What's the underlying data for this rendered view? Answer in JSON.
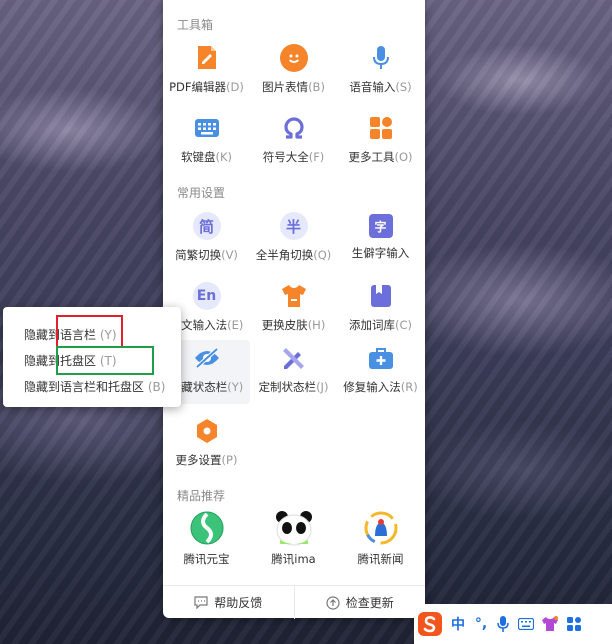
{
  "toolbox": {
    "title": "工具箱",
    "items": [
      {
        "label": "PDF编辑器",
        "key": "(D)"
      },
      {
        "label": "图片表情",
        "key": "(B)"
      },
      {
        "label": "语音输入",
        "key": "(S)"
      },
      {
        "label": "软键盘",
        "key": "(K)"
      },
      {
        "label": "符号大全",
        "key": "(F)"
      },
      {
        "label": "更多工具",
        "key": "(O)"
      }
    ]
  },
  "common": {
    "title": "常用设置",
    "items": [
      {
        "label": "简繁切换",
        "key": "(V)",
        "icon_text": "简"
      },
      {
        "label": "全半角切换",
        "key": "(Q)",
        "icon_text": "半"
      },
      {
        "label": "生僻字输入",
        "key": "",
        "icon_text": "字"
      },
      {
        "label": "英文输入法",
        "key": "(E)",
        "icon_text": "En"
      },
      {
        "label": "更换皮肤",
        "key": "(H)"
      },
      {
        "label": "添加词库",
        "key": "(C)"
      },
      {
        "label": "隐藏状态栏",
        "key": "(Y)"
      },
      {
        "label": "定制状态栏",
        "key": "(J)"
      },
      {
        "label": "修复输入法",
        "key": "(R)"
      },
      {
        "label": "更多设置",
        "key": "(P)"
      }
    ]
  },
  "recommend": {
    "title": "精品推荐",
    "items": [
      {
        "label": "腾讯元宝"
      },
      {
        "label": "腾讯ima"
      },
      {
        "label": "腾讯新闻"
      }
    ]
  },
  "footer": {
    "help": "帮助反馈",
    "update": "检查更新"
  },
  "context_menu": {
    "items": [
      {
        "prefix": "隐藏到",
        "target": "语言栏",
        "key": "(Y)"
      },
      {
        "prefix": "隐藏到",
        "target": "托盘区",
        "key": "(T)"
      },
      {
        "prefix": "",
        "target": "隐藏到语言栏和托盘区",
        "key": "(B)"
      }
    ]
  },
  "taskbar": {
    "ime_mode": "中",
    "punct": "°,"
  },
  "colors": {
    "orange": "#f5842a",
    "blue": "#4a90e2",
    "purple": "#6c6fd9",
    "red_box": "#e0202a",
    "green_box": "#1f9e4a"
  }
}
